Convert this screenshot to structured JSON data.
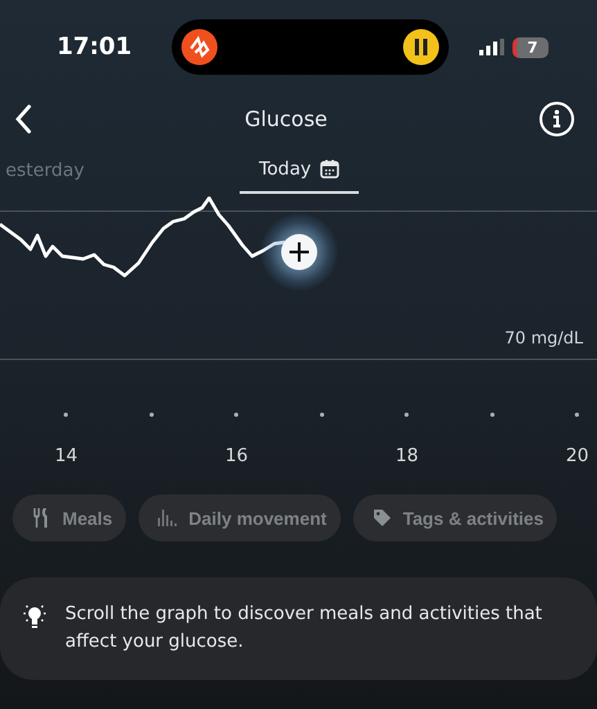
{
  "status_bar": {
    "time": "17:01",
    "battery": "7"
  },
  "header": {
    "title": "Glucose"
  },
  "tabs": [
    {
      "label": "esterday",
      "selected": false
    },
    {
      "label": "Today",
      "selected": true
    }
  ],
  "chart": {
    "reference_label": "70 mg/dL",
    "x_labels": [
      "14",
      "16",
      "18",
      "20"
    ]
  },
  "filters": [
    {
      "kind": "meals",
      "label": "Meals"
    },
    {
      "kind": "movement",
      "label": "Daily movement"
    },
    {
      "kind": "tags",
      "label": "Tags & activities"
    }
  ],
  "tip": {
    "text": "Scroll the graph to discover meals and activities that affect your glucose."
  }
}
